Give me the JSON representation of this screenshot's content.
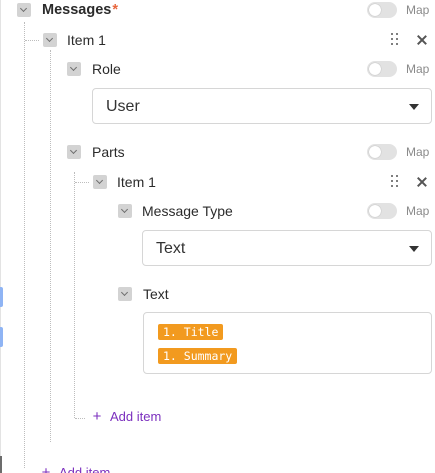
{
  "messages": {
    "label": "Messages",
    "required_mark": "*",
    "map_label": "Map",
    "items": [
      {
        "label": "Item 1",
        "role": {
          "label": "Role",
          "map_label": "Map",
          "value": "User"
        },
        "parts": {
          "label": "Parts",
          "map_label": "Map",
          "items": [
            {
              "label": "Item 1",
              "message_type": {
                "label": "Message Type",
                "map_label": "Map",
                "value": "Text"
              },
              "text": {
                "label": "Text",
                "chips": [
                  "1. Title",
                  "1. Summary"
                ]
              }
            }
          ],
          "add_item_label": "Add item"
        }
      }
    ],
    "add_item_label": "Add item"
  },
  "colors": {
    "accent_purple": "#7b2fbe",
    "chip_orange": "#f29a1f",
    "required_red": "#e8663d"
  },
  "icons": {
    "collapse": "chevron-down-icon",
    "drag": "drag-handle-icon",
    "remove": "close-icon",
    "add": "plus-icon",
    "dropdown": "caret-down-icon"
  }
}
